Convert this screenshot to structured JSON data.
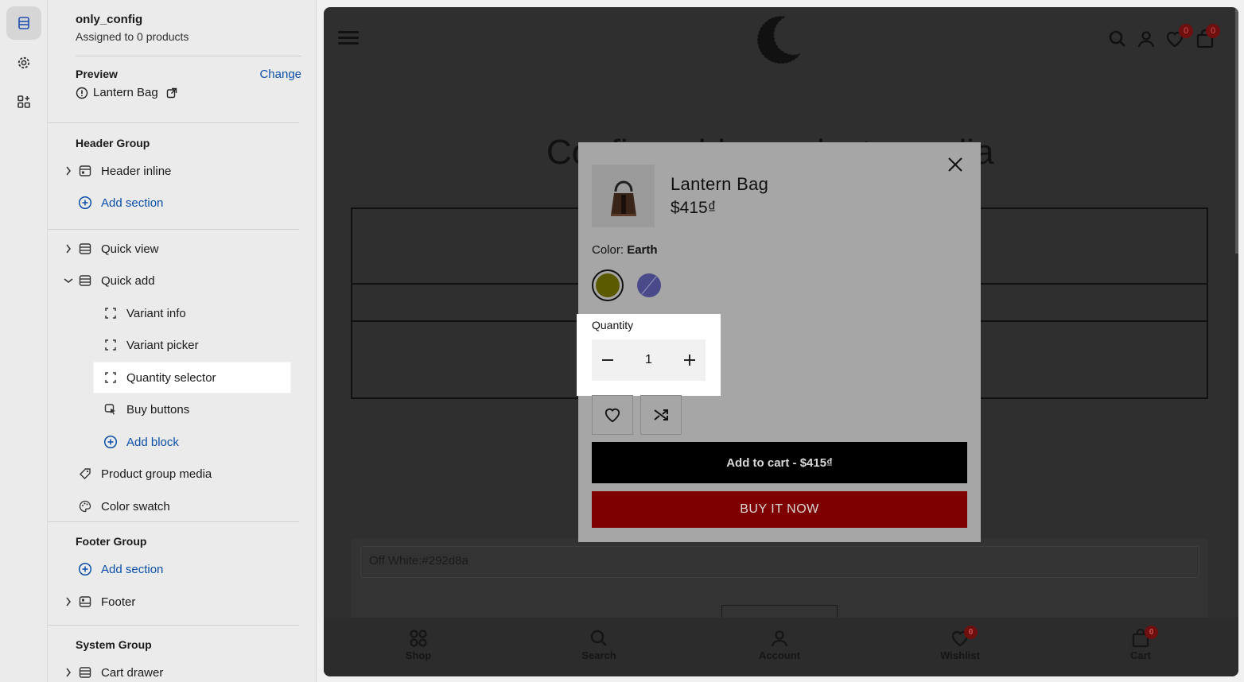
{
  "sidebar": {
    "template_name": "only_config",
    "assigned_text": "Assigned to 0 products",
    "preview_label": "Preview",
    "change_label": "Change",
    "preview_product": "Lantern Bag",
    "header_group": {
      "title": "Header Group",
      "items": [
        "Header inline"
      ],
      "add_section": "Add section"
    },
    "template_items": {
      "quick_view": "Quick view",
      "quick_add": "Quick add",
      "blocks": [
        "Variant info",
        "Variant picker",
        "Quantity selector",
        "Buy buttons"
      ],
      "add_block": "Add block",
      "product_group_media": "Product group media",
      "color_swatch": "Color swatch"
    },
    "footer_group": {
      "title": "Footer Group",
      "add_section": "Add section",
      "items": [
        "Footer"
      ]
    },
    "system_group": {
      "title": "System Group",
      "items": [
        "Cart drawer"
      ]
    }
  },
  "store": {
    "page_heading": "Configurable products media",
    "wishlist_count": "0",
    "cart_count": "0",
    "textarea_value": "Off White:#292d8a",
    "bottom_nav": {
      "shop": "Shop",
      "search": "Search",
      "account": "Account",
      "wishlist": "Wishlist",
      "wishlist_count": "0",
      "cart": "Cart",
      "cart_count": "0"
    }
  },
  "modal": {
    "product_title": "Lantern Bag",
    "price": "$415₫",
    "color_label": "Color:",
    "color_value": "Earth",
    "swatches": [
      {
        "name": "Earth",
        "color": "#5b5a00",
        "selected": true
      },
      {
        "name": "Off White",
        "color": "#4a4a8a",
        "selected": false,
        "unavailable": true
      }
    ],
    "quantity_label": "Quantity",
    "quantity_value": "1",
    "add_to_cart": "Add to cart - $415₫",
    "buy_now": "BUY IT NOW"
  },
  "colors": {
    "accent_link": "#0b4fa8",
    "buy_now_bg": "#7f0000",
    "badge": "#6e1010"
  }
}
